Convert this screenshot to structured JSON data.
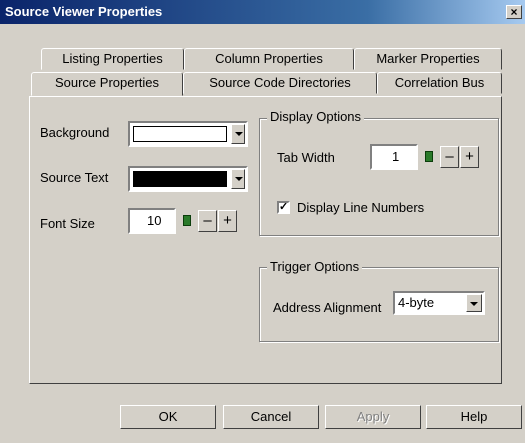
{
  "window": {
    "title": "Source Viewer Properties",
    "close_glyph": "×"
  },
  "tabs": {
    "row1": [
      {
        "label": "Listing Properties"
      },
      {
        "label": "Column Properties"
      },
      {
        "label": "Marker Properties"
      }
    ],
    "row2": [
      {
        "label": "Source Properties",
        "active": true
      },
      {
        "label": "Source Code Directories"
      },
      {
        "label": "Correlation Bus"
      }
    ]
  },
  "left": {
    "background_label": "Background",
    "background_color": "#ffffff",
    "source_text_label": "Source Text",
    "source_text_color": "#000000",
    "font_size_label": "Font Size",
    "font_size_value": "10"
  },
  "display_options": {
    "title": "Display Options",
    "tab_width_label": "Tab Width",
    "tab_width_value": "1",
    "line_numbers_label": "Display Line Numbers",
    "line_numbers_checked": true
  },
  "trigger_options": {
    "title": "Trigger Options",
    "address_alignment_label": "Address Alignment",
    "address_alignment_value": "4-byte"
  },
  "stepper": {
    "minus": "–",
    "plus": "+"
  },
  "buttons": {
    "ok": "OK",
    "cancel": "Cancel",
    "apply": "Apply",
    "help": "Help"
  }
}
